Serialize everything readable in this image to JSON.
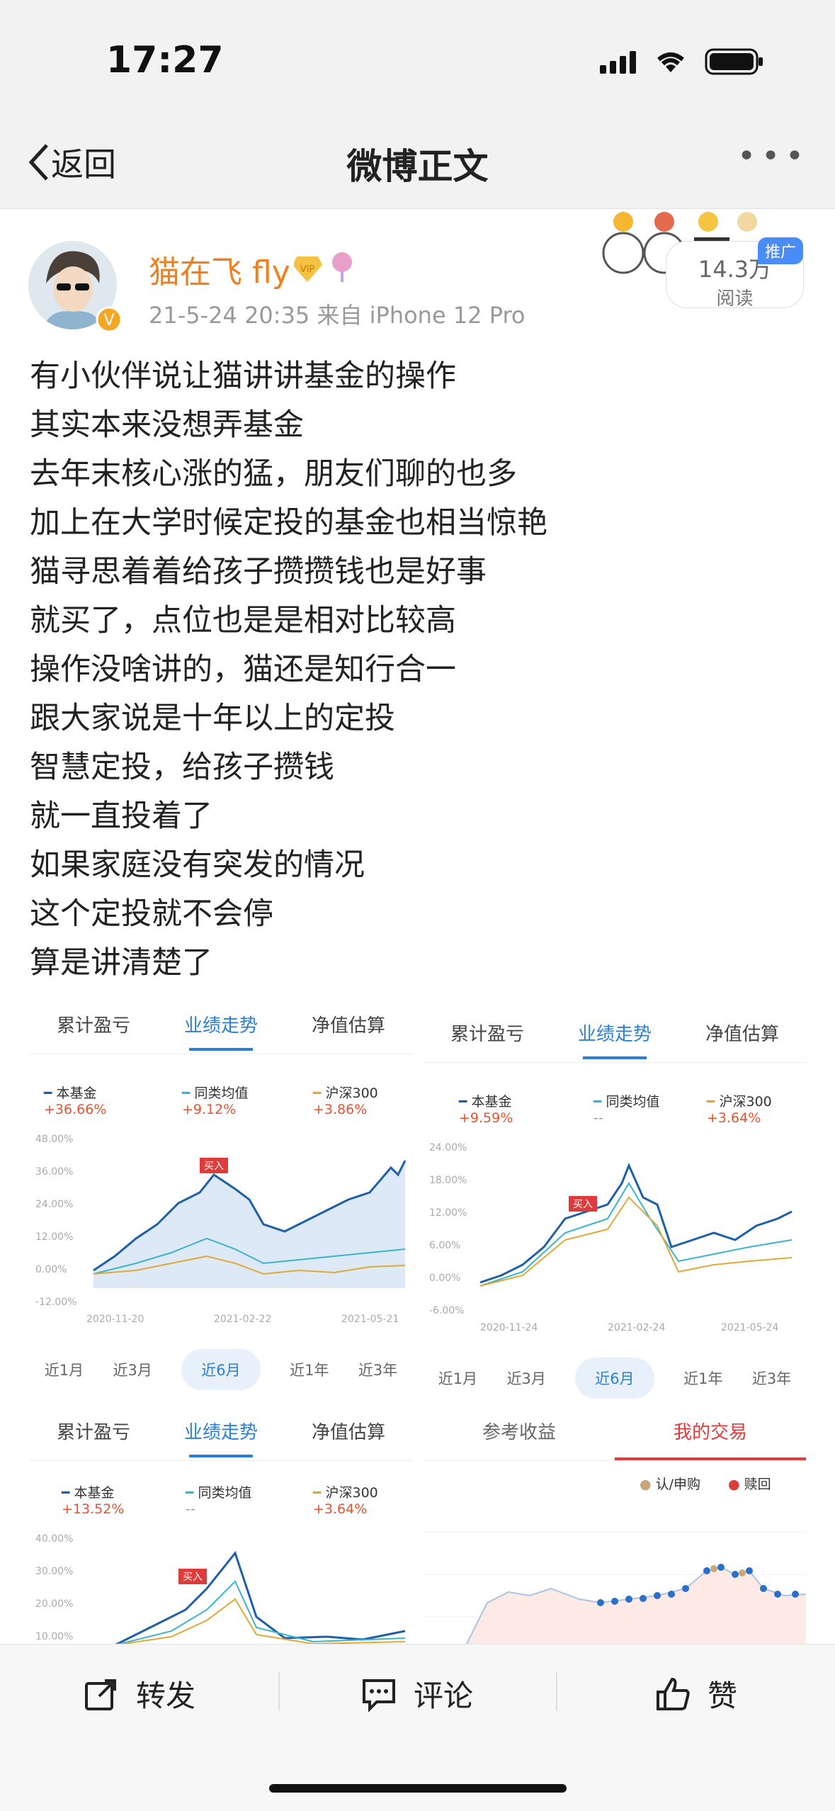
{
  "status": {
    "time": "17:27"
  },
  "nav": {
    "back": "返回",
    "title": "微博正文"
  },
  "post": {
    "username": "猫在飞 fly",
    "meta": "21-5-24 20:35  来自 iPhone 12 Pro",
    "reads": "14.3万",
    "reads_label": "阅读",
    "promo": "推广",
    "lines": [
      "有小伙伴说让猫讲讲基金的操作",
      "其实本来没想弄基金",
      "去年末核心涨的猛，朋友们聊的也多",
      "加上在大学时候定投的基金也相当惊艳",
      "猫寻思着着给孩子攒攒钱也是好事",
      "就买了，点位也是是相对比较高",
      "操作没啥讲的，猫还是知行合一",
      "跟大家说是十年以上的定投",
      "智慧定投，给孩子攒钱",
      "就一直投着了",
      "如果家庭没有突发的情况",
      "这个定投就不会停",
      "算是讲清楚了"
    ]
  },
  "cards": [
    {
      "tabs": [
        "累计盈亏",
        "业绩走势",
        "净值估算"
      ],
      "legend": [
        {
          "n": "本基金",
          "v": "+36.66%"
        },
        {
          "n": "同类均值",
          "v": "+9.12%"
        },
        {
          "n": "沪深300",
          "v": "+3.86%"
        }
      ],
      "yticks": [
        "48.00%",
        "36.00%",
        "24.00%",
        "12.00%",
        "0.00%",
        "-12.00%"
      ],
      "xticks": [
        "2020-11-20",
        "2021-02-22",
        "2021-05-21"
      ],
      "buy": "买入",
      "ranges": [
        "近1月",
        "近3月",
        "近6月",
        "近1年",
        "近3年"
      ]
    },
    {
      "tabs": [
        "累计盈亏",
        "业绩走势",
        "净值估算"
      ],
      "legend": [
        {
          "n": "本基金",
          "v": "+9.59%"
        },
        {
          "n": "同类均值",
          "v": "--"
        },
        {
          "n": "沪深300",
          "v": "+3.64%"
        }
      ],
      "yticks": [
        "24.00%",
        "18.00%",
        "12.00%",
        "6.00%",
        "0.00%",
        "-6.00%"
      ],
      "xticks": [
        "2020-11-24",
        "2021-02-24",
        "2021-05-24"
      ],
      "buy": "买入",
      "ranges": [
        "近1月",
        "近3月",
        "近6月",
        "近1年",
        "近3年"
      ]
    },
    {
      "tabs": [
        "累计盈亏",
        "业绩走势",
        "净值估算"
      ],
      "legend": [
        {
          "n": "本基金",
          "v": "+13.52%"
        },
        {
          "n": "同类均值",
          "v": "--"
        },
        {
          "n": "沪深300",
          "v": "+3.64%"
        }
      ],
      "yticks": [
        "40.00%",
        "30.00%",
        "20.00%",
        "10.00%"
      ],
      "buy": "买入"
    },
    {
      "tabs": [
        "参考收益",
        "我的交易"
      ],
      "legend": [
        {
          "n": "认/申购"
        },
        {
          "n": "赎回"
        }
      ]
    }
  ],
  "actions": {
    "repost": "转发",
    "comment": "评论",
    "like": "赞"
  }
}
